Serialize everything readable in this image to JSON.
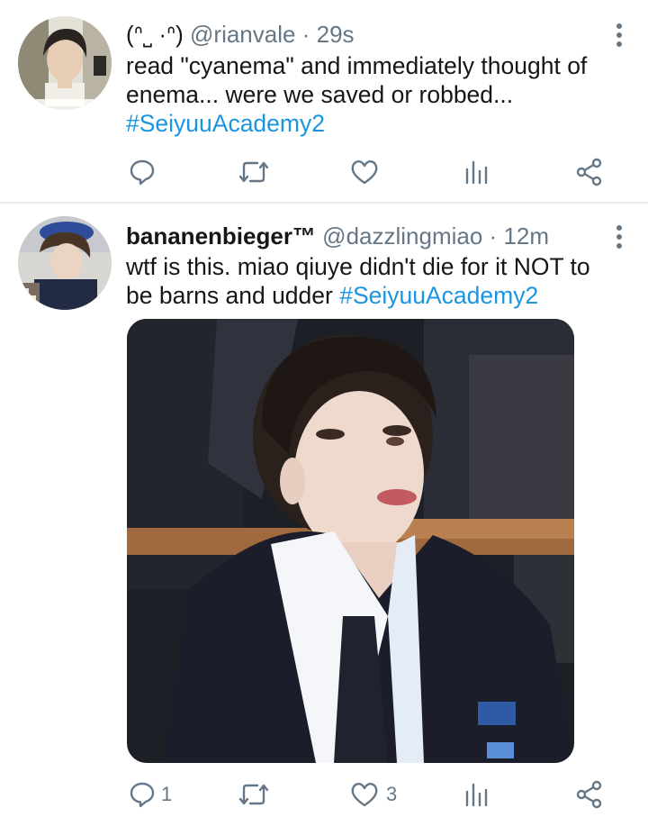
{
  "tweets": [
    {
      "emote": "(ᐢ˽ ·ᐢ)",
      "handle": "@rianvale",
      "sep": "·",
      "time": "29s",
      "text_line1": "read \"cyanema\" and immediately thought of",
      "text_line2": "enema... were we saved or robbed...",
      "hashtag": "#SeiyuuAcademy2",
      "actions": {
        "reply_count": "",
        "like_count": ""
      }
    },
    {
      "display_name": "bananenbieger™",
      "handle": "@dazzlingmiao",
      "sep": "·",
      "time": "12m",
      "text_line1": "wtf is this. miao qiuye didn't die for it NOT to",
      "text_line2_prefix": "be barns and udder ",
      "hashtag": "#SeiyuuAcademy2",
      "actions": {
        "reply_count": "1",
        "like_count": "3"
      }
    }
  ],
  "icons": {
    "reply": "reply-icon",
    "retweet": "retweet-icon",
    "like": "heart-icon",
    "analytics": "analytics-icon",
    "share": "share-icon",
    "more": "more-vertical-icon"
  },
  "colors": {
    "link": "#1b95e0",
    "muted": "#657786",
    "divider": "#e6ecf0"
  }
}
